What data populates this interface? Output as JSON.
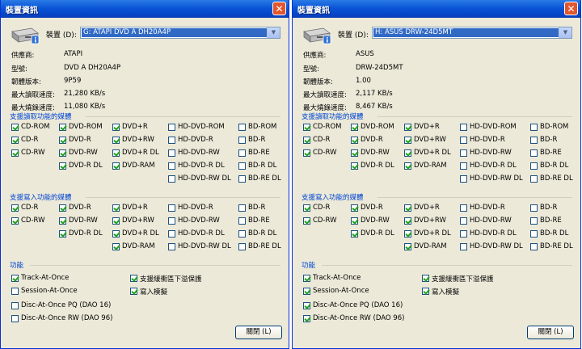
{
  "windows": [
    {
      "title": "裝置資訊",
      "close_glyph": "✕",
      "device_label": "裝置 (D):",
      "device_value": "G: ATAPI DVD A  DH20A4P",
      "info": [
        {
          "label": "供應商:",
          "value": "ATAPI"
        },
        {
          "label": "型號:",
          "value": "DVD A  DH20A4P"
        },
        {
          "label": "韌體版本:",
          "value": "9P59"
        },
        {
          "label": "最大讀取速度:",
          "value": "21,280 KB/s"
        },
        {
          "label": "最大燒錄速度:",
          "value": "11,080 KB/s"
        }
      ],
      "read_title": "支援讀取功能的媒體",
      "read_media": [
        [
          {
            "label": "CD-ROM",
            "checked": true
          },
          {
            "label": "CD-R",
            "checked": true
          },
          {
            "label": "CD-RW",
            "checked": true
          }
        ],
        [
          {
            "label": "DVD-ROM",
            "checked": true
          },
          {
            "label": "DVD-R",
            "checked": true
          },
          {
            "label": "DVD-RW",
            "checked": true
          },
          {
            "label": "DVD-R DL",
            "checked": true
          }
        ],
        [
          {
            "label": "DVD+R",
            "checked": true
          },
          {
            "label": "DVD+RW",
            "checked": true
          },
          {
            "label": "DVD+R DL",
            "checked": true
          },
          {
            "label": "DVD-RAM",
            "checked": true
          }
        ],
        [
          {
            "label": "HD-DVD-ROM",
            "checked": false
          },
          {
            "label": "HD-DVD-R",
            "checked": false
          },
          {
            "label": "HD-DVD-RW",
            "checked": false
          },
          {
            "label": "HD-DVD-R DL",
            "checked": false
          },
          {
            "label": "HD-DVD-RW DL",
            "checked": false
          }
        ],
        [
          {
            "label": "BD-ROM",
            "checked": false
          },
          {
            "label": "BD-R",
            "checked": false
          },
          {
            "label": "BD-RE",
            "checked": false
          },
          {
            "label": "BD-R DL",
            "checked": false
          },
          {
            "label": "BD-RE DL",
            "checked": false
          }
        ]
      ],
      "write_title": "支援寫入功能的媒體",
      "write_media": [
        [
          {
            "label": "CD-R",
            "checked": true
          },
          {
            "label": "CD-RW",
            "checked": true
          }
        ],
        [
          {
            "label": "DVD-R",
            "checked": true
          },
          {
            "label": "DVD-RW",
            "checked": true
          },
          {
            "label": "DVD-R DL",
            "checked": true
          }
        ],
        [
          {
            "label": "DVD+R",
            "checked": true
          },
          {
            "label": "DVD+RW",
            "checked": true
          },
          {
            "label": "DVD+R DL",
            "checked": true
          },
          {
            "label": "DVD-RAM",
            "checked": true
          }
        ],
        [
          {
            "label": "HD-DVD-R",
            "checked": false
          },
          {
            "label": "HD-DVD-RW",
            "checked": false
          },
          {
            "label": "HD-DVD-R DL",
            "checked": false
          },
          {
            "label": "HD-DVD-RW DL",
            "checked": false
          }
        ],
        [
          {
            "label": "BD-R",
            "checked": false
          },
          {
            "label": "BD-RE",
            "checked": false
          },
          {
            "label": "BD-R DL",
            "checked": false
          },
          {
            "label": "BD-RE DL",
            "checked": false
          }
        ]
      ],
      "func_title": "功能",
      "functions_left": [
        {
          "label": "Track-At-Once",
          "checked": true
        },
        {
          "label": "Session-At-Once",
          "checked": false
        },
        {
          "label": "Disc-At-Once PQ (DAO 16)",
          "checked": false
        },
        {
          "label": "Disc-At-Once RW (DAO 96)",
          "checked": false
        }
      ],
      "functions_right": [
        {
          "label": "支援緩衝區下溢保護",
          "checked": true
        },
        {
          "label": "寫入模擬",
          "checked": true
        }
      ],
      "close_button": "關閉 (L)"
    },
    {
      "title": "裝置資訊",
      "close_glyph": "✕",
      "device_label": "裝置 (D):",
      "device_value": "H: ASUS DRW-24D5MT",
      "info": [
        {
          "label": "供應商:",
          "value": "ASUS"
        },
        {
          "label": "型號:",
          "value": "DRW-24D5MT"
        },
        {
          "label": "韌體版本:",
          "value": "1.00"
        },
        {
          "label": "最大讀取速度:",
          "value": "2,117 KB/s"
        },
        {
          "label": "最大燒錄速度:",
          "value": "8,467 KB/s"
        }
      ],
      "read_title": "支援讀取功能的媒體",
      "read_media": [
        [
          {
            "label": "CD-ROM",
            "checked": true
          },
          {
            "label": "CD-R",
            "checked": true
          },
          {
            "label": "CD-RW",
            "checked": true
          }
        ],
        [
          {
            "label": "DVD-ROM",
            "checked": true
          },
          {
            "label": "DVD-R",
            "checked": true
          },
          {
            "label": "DVD-RW",
            "checked": true
          },
          {
            "label": "DVD-R DL",
            "checked": true
          }
        ],
        [
          {
            "label": "DVD+R",
            "checked": true
          },
          {
            "label": "DVD+RW",
            "checked": true
          },
          {
            "label": "DVD+R DL",
            "checked": true
          },
          {
            "label": "DVD-RAM",
            "checked": true
          }
        ],
        [
          {
            "label": "HD-DVD-ROM",
            "checked": false
          },
          {
            "label": "HD-DVD-R",
            "checked": false
          },
          {
            "label": "HD-DVD-RW",
            "checked": false
          },
          {
            "label": "HD-DVD-R DL",
            "checked": false
          },
          {
            "label": "HD-DVD-RW DL",
            "checked": false
          }
        ],
        [
          {
            "label": "BD-ROM",
            "checked": false
          },
          {
            "label": "BD-R",
            "checked": false
          },
          {
            "label": "BD-RE",
            "checked": false
          },
          {
            "label": "BD-R DL",
            "checked": false
          },
          {
            "label": "BD-RE DL",
            "checked": false
          }
        ]
      ],
      "write_title": "支援寫入功能的媒體",
      "write_media": [
        [
          {
            "label": "CD-R",
            "checked": true
          },
          {
            "label": "CD-RW",
            "checked": true
          }
        ],
        [
          {
            "label": "DVD-R",
            "checked": true
          },
          {
            "label": "DVD-RW",
            "checked": true
          },
          {
            "label": "DVD-R DL",
            "checked": true
          }
        ],
        [
          {
            "label": "DVD+R",
            "checked": true
          },
          {
            "label": "DVD+RW",
            "checked": true
          },
          {
            "label": "DVD+R DL",
            "checked": true
          },
          {
            "label": "DVD-RAM",
            "checked": true
          }
        ],
        [
          {
            "label": "HD-DVD-R",
            "checked": false
          },
          {
            "label": "HD-DVD-RW",
            "checked": false
          },
          {
            "label": "HD-DVD-R DL",
            "checked": false
          },
          {
            "label": "HD-DVD-RW DL",
            "checked": false
          }
        ],
        [
          {
            "label": "BD-R",
            "checked": false
          },
          {
            "label": "BD-RE",
            "checked": false
          },
          {
            "label": "BD-R DL",
            "checked": false
          },
          {
            "label": "BD-RE DL",
            "checked": false
          }
        ]
      ],
      "func_title": "功能",
      "functions_left": [
        {
          "label": "Track-At-Once",
          "checked": true
        },
        {
          "label": "Session-At-Once",
          "checked": true
        },
        {
          "label": "Disc-At-Once PQ (DAO 16)",
          "checked": true
        },
        {
          "label": "Disc-At-Once RW (DAO 96)",
          "checked": true
        }
      ],
      "functions_right": [
        {
          "label": "支援緩衝區下溢保護",
          "checked": true
        },
        {
          "label": "寫入模擬",
          "checked": true
        }
      ],
      "close_button": "關閉 (L)"
    }
  ]
}
